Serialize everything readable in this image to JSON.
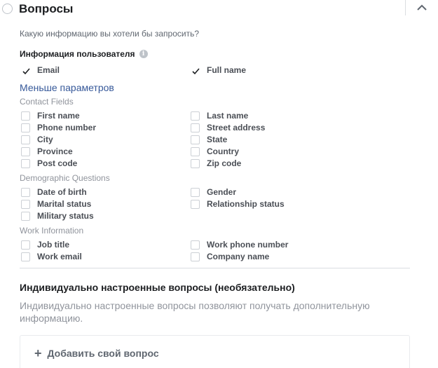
{
  "header": {
    "title": "Вопросы"
  },
  "subtitle": "Какую информацию вы хотели бы запросить?",
  "user_info": {
    "label": "Информация пользователя",
    "fields": [
      {
        "label": "Email",
        "checked": true
      },
      {
        "label": "Full name",
        "checked": true
      }
    ]
  },
  "less_link": "Меньше параметров",
  "groups": [
    {
      "title": "Contact Fields",
      "fields": [
        "First name",
        "Last name",
        "Phone number",
        "Street address",
        "City",
        "State",
        "Province",
        "Country",
        "Post code",
        "Zip code"
      ]
    },
    {
      "title": "Demographic Questions",
      "fields": [
        "Date of birth",
        "Gender",
        "Marital status",
        "Relationship status",
        "Military status"
      ]
    },
    {
      "title": "Work Information",
      "fields": [
        "Job title",
        "Work phone number",
        "Work email",
        "Company name"
      ]
    }
  ],
  "custom": {
    "title": "Индивидуально настроенные вопросы (необязательно)",
    "description": "Индивидуально настроенные вопросы позволяют получать дополнительную информацию.",
    "add_label": "Добавить свой вопрос"
  },
  "colors": {
    "link": "#365899",
    "checkmark": "#1c1e21",
    "muted": "#90949c"
  }
}
